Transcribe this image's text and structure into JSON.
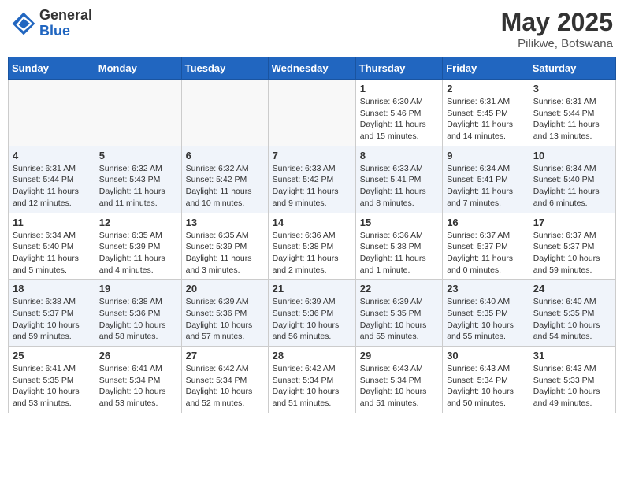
{
  "header": {
    "logo_general": "General",
    "logo_blue": "Blue",
    "month_title": "May 2025",
    "location": "Pilikwe, Botswana"
  },
  "weekdays": [
    "Sunday",
    "Monday",
    "Tuesday",
    "Wednesday",
    "Thursday",
    "Friday",
    "Saturday"
  ],
  "weeks": [
    [
      {
        "day": "",
        "info": ""
      },
      {
        "day": "",
        "info": ""
      },
      {
        "day": "",
        "info": ""
      },
      {
        "day": "",
        "info": ""
      },
      {
        "day": "1",
        "info": "Sunrise: 6:30 AM\nSunset: 5:46 PM\nDaylight: 11 hours and 15 minutes."
      },
      {
        "day": "2",
        "info": "Sunrise: 6:31 AM\nSunset: 5:45 PM\nDaylight: 11 hours and 14 minutes."
      },
      {
        "day": "3",
        "info": "Sunrise: 6:31 AM\nSunset: 5:44 PM\nDaylight: 11 hours and 13 minutes."
      }
    ],
    [
      {
        "day": "4",
        "info": "Sunrise: 6:31 AM\nSunset: 5:44 PM\nDaylight: 11 hours and 12 minutes."
      },
      {
        "day": "5",
        "info": "Sunrise: 6:32 AM\nSunset: 5:43 PM\nDaylight: 11 hours and 11 minutes."
      },
      {
        "day": "6",
        "info": "Sunrise: 6:32 AM\nSunset: 5:42 PM\nDaylight: 11 hours and 10 minutes."
      },
      {
        "day": "7",
        "info": "Sunrise: 6:33 AM\nSunset: 5:42 PM\nDaylight: 11 hours and 9 minutes."
      },
      {
        "day": "8",
        "info": "Sunrise: 6:33 AM\nSunset: 5:41 PM\nDaylight: 11 hours and 8 minutes."
      },
      {
        "day": "9",
        "info": "Sunrise: 6:34 AM\nSunset: 5:41 PM\nDaylight: 11 hours and 7 minutes."
      },
      {
        "day": "10",
        "info": "Sunrise: 6:34 AM\nSunset: 5:40 PM\nDaylight: 11 hours and 6 minutes."
      }
    ],
    [
      {
        "day": "11",
        "info": "Sunrise: 6:34 AM\nSunset: 5:40 PM\nDaylight: 11 hours and 5 minutes."
      },
      {
        "day": "12",
        "info": "Sunrise: 6:35 AM\nSunset: 5:39 PM\nDaylight: 11 hours and 4 minutes."
      },
      {
        "day": "13",
        "info": "Sunrise: 6:35 AM\nSunset: 5:39 PM\nDaylight: 11 hours and 3 minutes."
      },
      {
        "day": "14",
        "info": "Sunrise: 6:36 AM\nSunset: 5:38 PM\nDaylight: 11 hours and 2 minutes."
      },
      {
        "day": "15",
        "info": "Sunrise: 6:36 AM\nSunset: 5:38 PM\nDaylight: 11 hours and 1 minute."
      },
      {
        "day": "16",
        "info": "Sunrise: 6:37 AM\nSunset: 5:37 PM\nDaylight: 11 hours and 0 minutes."
      },
      {
        "day": "17",
        "info": "Sunrise: 6:37 AM\nSunset: 5:37 PM\nDaylight: 10 hours and 59 minutes."
      }
    ],
    [
      {
        "day": "18",
        "info": "Sunrise: 6:38 AM\nSunset: 5:37 PM\nDaylight: 10 hours and 59 minutes."
      },
      {
        "day": "19",
        "info": "Sunrise: 6:38 AM\nSunset: 5:36 PM\nDaylight: 10 hours and 58 minutes."
      },
      {
        "day": "20",
        "info": "Sunrise: 6:39 AM\nSunset: 5:36 PM\nDaylight: 10 hours and 57 minutes."
      },
      {
        "day": "21",
        "info": "Sunrise: 6:39 AM\nSunset: 5:36 PM\nDaylight: 10 hours and 56 minutes."
      },
      {
        "day": "22",
        "info": "Sunrise: 6:39 AM\nSunset: 5:35 PM\nDaylight: 10 hours and 55 minutes."
      },
      {
        "day": "23",
        "info": "Sunrise: 6:40 AM\nSunset: 5:35 PM\nDaylight: 10 hours and 55 minutes."
      },
      {
        "day": "24",
        "info": "Sunrise: 6:40 AM\nSunset: 5:35 PM\nDaylight: 10 hours and 54 minutes."
      }
    ],
    [
      {
        "day": "25",
        "info": "Sunrise: 6:41 AM\nSunset: 5:35 PM\nDaylight: 10 hours and 53 minutes."
      },
      {
        "day": "26",
        "info": "Sunrise: 6:41 AM\nSunset: 5:34 PM\nDaylight: 10 hours and 53 minutes."
      },
      {
        "day": "27",
        "info": "Sunrise: 6:42 AM\nSunset: 5:34 PM\nDaylight: 10 hours and 52 minutes."
      },
      {
        "day": "28",
        "info": "Sunrise: 6:42 AM\nSunset: 5:34 PM\nDaylight: 10 hours and 51 minutes."
      },
      {
        "day": "29",
        "info": "Sunrise: 6:43 AM\nSunset: 5:34 PM\nDaylight: 10 hours and 51 minutes."
      },
      {
        "day": "30",
        "info": "Sunrise: 6:43 AM\nSunset: 5:34 PM\nDaylight: 10 hours and 50 minutes."
      },
      {
        "day": "31",
        "info": "Sunrise: 6:43 AM\nSunset: 5:33 PM\nDaylight: 10 hours and 49 minutes."
      }
    ]
  ]
}
